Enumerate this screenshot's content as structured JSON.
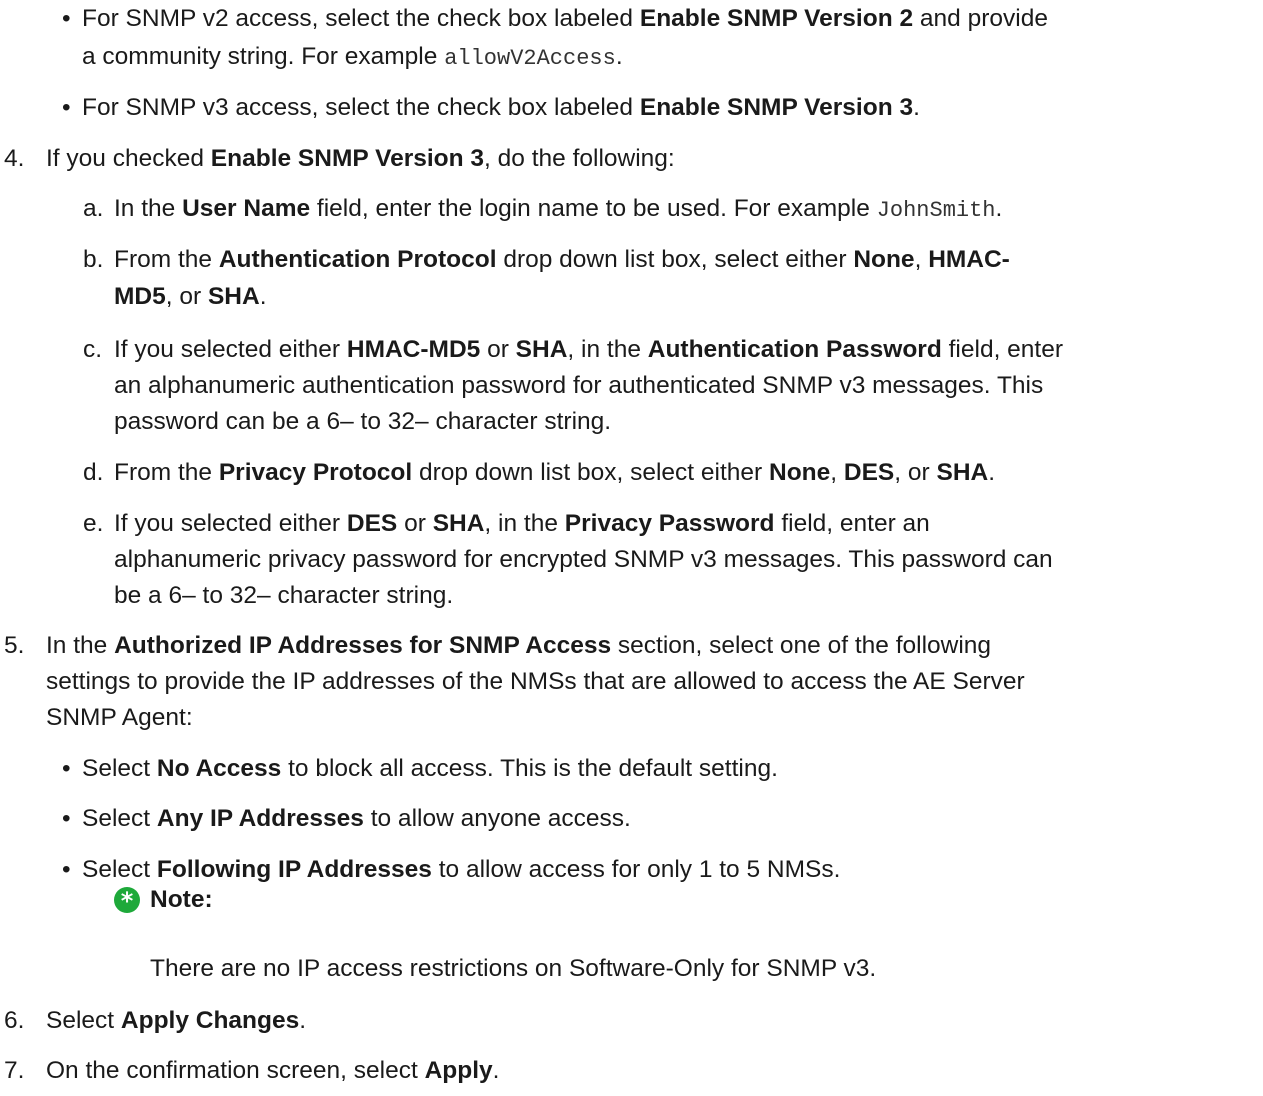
{
  "bullets_top": [
    {
      "bullet": "•",
      "line1": [
        "For SNMP v2 access, select the check box labeled ",
        "Enable SNMP Version 2",
        " and provide"
      ],
      "line2": [
        "a community string. For example ",
        "allowV2Access",
        "."
      ]
    },
    {
      "bullet": "•",
      "line1": [
        "For SNMP v3 access, select the check box labeled ",
        "Enable SNMP Version 3",
        "."
      ]
    }
  ],
  "step4": {
    "number": "4.",
    "parts": [
      "If you checked ",
      "Enable SNMP Version 3",
      ", do the following:"
    ],
    "substeps": [
      {
        "letter": "a.",
        "line1": [
          "In the ",
          "User Name",
          " field, enter the login name to be used. For example ",
          "JohnSmith",
          "."
        ]
      },
      {
        "letter": "b.",
        "line1": [
          "From the ",
          "Authentication Protocol",
          " drop down list box, select either ",
          "None",
          ", ",
          "HMAC-"
        ],
        "line2": [
          "MD5",
          ", or ",
          "SHA",
          "."
        ]
      },
      {
        "letter": "c.",
        "line1": [
          "If you selected either ",
          "HMAC-MD5",
          " or ",
          "SHA",
          ", in the ",
          "Authentication Password",
          " field, enter"
        ],
        "line2": "an alphanumeric authentication password for authenticated SNMP v3 messages. This",
        "line3": "password can be a 6– to 32– character string."
      },
      {
        "letter": "d.",
        "line1": [
          "From the ",
          "Privacy Protocol",
          " drop down list box, select either ",
          "None",
          ", ",
          "DES",
          ", or ",
          "SHA",
          "."
        ]
      },
      {
        "letter": "e.",
        "line1": [
          "If you selected either ",
          "DES",
          " or ",
          "SHA",
          ", in the ",
          "Privacy Password",
          " field, enter an"
        ],
        "line2": "alphanumeric privacy password for encrypted SNMP v3 messages. This password can",
        "line3": "be a 6– to 32– character string."
      }
    ]
  },
  "step5": {
    "number": "5.",
    "line1": [
      "In the ",
      "Authorized IP Addresses for SNMP Access",
      " section, select one of the following"
    ],
    "line2": "settings to provide the IP addresses of the NMSs that are allowed to access the AE Server",
    "line3": "SNMP Agent:",
    "bullets": [
      {
        "bullet": "•",
        "parts": [
          "Select ",
          "No Access",
          " to block all access. This is the default setting."
        ]
      },
      {
        "bullet": "•",
        "parts": [
          "Select ",
          "Any IP Addresses",
          " to allow anyone access."
        ]
      },
      {
        "bullet": "•",
        "parts": [
          "Select ",
          "Following IP Addresses",
          " to allow access for only 1 to 5 NMSs."
        ]
      }
    ],
    "note": {
      "icon": "note-star-icon",
      "icon_color": "#1ea93a",
      "label": "Note:",
      "text": "There are no IP access restrictions on Software-Only for SNMP v3."
    }
  },
  "step6": {
    "number": "6.",
    "parts": [
      "Select ",
      "Apply Changes",
      "."
    ]
  },
  "step7": {
    "number": "7.",
    "parts": [
      "On the confirmation screen, select ",
      "Apply",
      "."
    ]
  }
}
